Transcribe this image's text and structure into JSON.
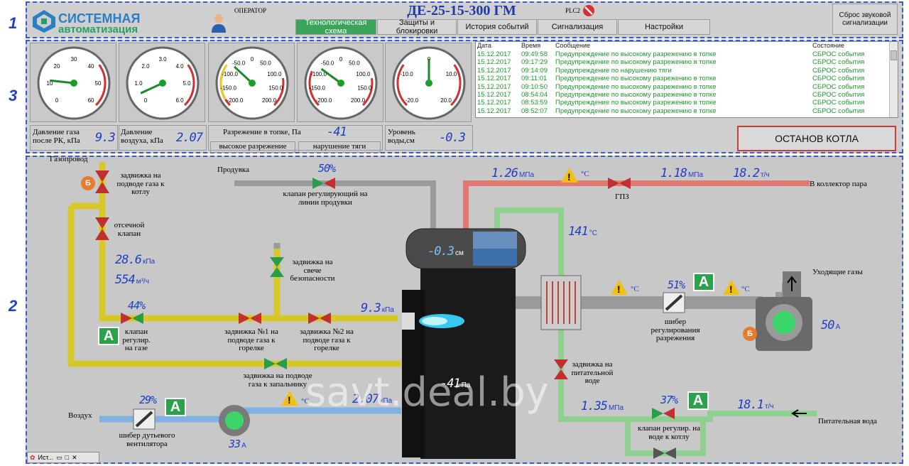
{
  "header": {
    "logo_line1": "СИСТЕМНАЯ",
    "logo_line2": "автоматизация",
    "operator": "ОПЕРАТОР",
    "title": "ДЕ-25-15-300 ГМ",
    "plc": "PLC2",
    "reset_sound": "Сброс звуковой сигнализации"
  },
  "tabs": [
    {
      "label": "Технологическая схема"
    },
    {
      "label": "Защиты и блокировки"
    },
    {
      "label": "История событий"
    },
    {
      "label": "Сигнализация"
    },
    {
      "label": "Настройки"
    }
  ],
  "side_numbers": {
    "header": "1",
    "schema": "2",
    "gauges": "3"
  },
  "gauges": [
    {
      "ticks": [
        "0",
        "10",
        "20",
        "30",
        "40",
        "50",
        "60"
      ],
      "label": "Давление газа после РК, кПа",
      "value": "9.3"
    },
    {
      "ticks": [
        "0",
        "1.0",
        "2.0",
        "3.0",
        "4.0",
        "5.0",
        "6.0"
      ],
      "label": "Давление воздуха, кПа",
      "value": "2.07"
    },
    {
      "ticks": [
        "-200.0",
        "-150.0",
        "-100.0",
        "-50.0",
        "0",
        "50.0",
        "100.0",
        "150.0",
        "200.0"
      ],
      "label": "Разрежение в топке, Па",
      "value": "-41"
    },
    {
      "ticks": [
        "-200.0",
        "-150.0",
        "-100.0",
        "-50.0",
        "0",
        "50.0",
        "100.0",
        "150.0",
        "200.0"
      ]
    },
    {
      "ticks": [
        "-20.0",
        "-10.0",
        "0",
        "10.0",
        "20.0"
      ],
      "label": "Уровень воды,см",
      "value": "-0.3"
    }
  ],
  "vacuum_states": {
    "high": "высокое разрежение",
    "draft": "нарушение тяги"
  },
  "events": {
    "headers": {
      "date": "Дата",
      "time": "Время",
      "message": "Сообщение",
      "state": "Состояние"
    },
    "rows": [
      {
        "date": "15.12.2017",
        "time": "09:49:58",
        "message": "Предупреждение  по высокому разрежению в топке",
        "state": "СБРОС события"
      },
      {
        "date": "15.12.2017",
        "time": "09:17:29",
        "message": "Предупреждение  по высокому разрежению в топке",
        "state": "СБРОС события"
      },
      {
        "date": "15.12.2017",
        "time": "09:14:09",
        "message": "Предупреждение  по нарушению тяги",
        "state": "СБРОС события"
      },
      {
        "date": "15.12.2017",
        "time": "09:11:01",
        "message": "Предупреждение  по высокому разрежению в топке",
        "state": "СБРОС события"
      },
      {
        "date": "15.12.2017",
        "time": "09:10:50",
        "message": "Предупреждение  по высокому разрежению в топке",
        "state": "СБРОС события"
      },
      {
        "date": "15.12.2017",
        "time": "08:54:04",
        "message": "Предупреждение  по высокому разрежению в топке",
        "state": "СБРОС события"
      },
      {
        "date": "15.12.2017",
        "time": "08:53:59",
        "message": "Предупреждение  по высокому разрежению в топке",
        "state": "СБРОС события"
      },
      {
        "date": "15.12.2017",
        "time": "08:52:07",
        "message": "Предупреждение  по высокому разрежению в топке",
        "state": "СБРОС события"
      }
    ]
  },
  "stop_button": "ОСТАНОВ КОТЛА",
  "schema": {
    "gas_line": "Газопровод",
    "valve_gas_inlet": "задвижка на подводе газа к котлу",
    "shutoff_valve": "отсечной клапан",
    "gas_pressure": "28.6",
    "gas_pressure_unit": "кПа",
    "gas_flow": "554",
    "gas_flow_unit": "м³/ч",
    "gas_valve_pct": "44%",
    "gas_valve_label": "клапан регулир. на газе",
    "purge": "Продувка",
    "purge_pct": "50%",
    "purge_valve": "клапан регулирующий на линии продувки",
    "safety_valve": "задвижка на свече безопасности",
    "valve1": "задвижка №1 на подводе газа к горелке",
    "valve2": "задвижка №2 на подводе газа к горелке",
    "burner_pressure": "9.3",
    "burner_pressure_unit": "кПа",
    "pilot_valve": "задвижка на подводе газа к запальнику",
    "air": "Воздух",
    "air_pct": "29%",
    "air_damper": "шибер дутьевого вентилятора",
    "fan_current": "33",
    "fan_current_unit": "А",
    "air_pressure": "2.07",
    "air_pressure_unit": "кПа",
    "steam_pressure": "1.26",
    "steam_pressure_unit": "МПа",
    "steam_temp_unit": "°С",
    "gpz": "ГПЗ",
    "steam_out_pressure": "1.18",
    "steam_out_pressure_unit": "МПа",
    "steam_flow": "18.2",
    "steam_flow_unit": "т/ч",
    "steam_collector": "В коллектор пара",
    "drum_level": "-0.3",
    "drum_level_unit": "см",
    "eco_temp": "141",
    "eco_temp_unit": "°С",
    "furnace_vacuum": "-41",
    "furnace_vacuum_unit": "Па",
    "flue_temp_unit": "°С",
    "flue_pct": "51%",
    "flue_damper": "шибер регулирования разрежения",
    "exhaust": "Уходящие газы",
    "exhaust_temp_unit": "°С",
    "smoke_current": "50",
    "smoke_current_unit": "А",
    "feed_valve_label": "задвижка на питательной воде",
    "feed_pressure": "1.35",
    "feed_pressure_unit": "МПа",
    "feed_pct": "37%",
    "feed_valve": "клапан регулир. на воде к котлу",
    "feed_flow": "18.1",
    "feed_flow_unit": "т/ч",
    "feed_water": "Питательная вода",
    "mode_A": "A",
    "mode_B": "Б",
    "watermark": "savt.deal.by"
  },
  "taskbar": {
    "label": "Ист..."
  },
  "colors": {
    "gas": "#d6c829",
    "air": "#7fb2e0",
    "steam": "#e07a73",
    "water": "#8fcf8f",
    "digits": "#1c3fc8",
    "events": "#1b9a2b"
  }
}
